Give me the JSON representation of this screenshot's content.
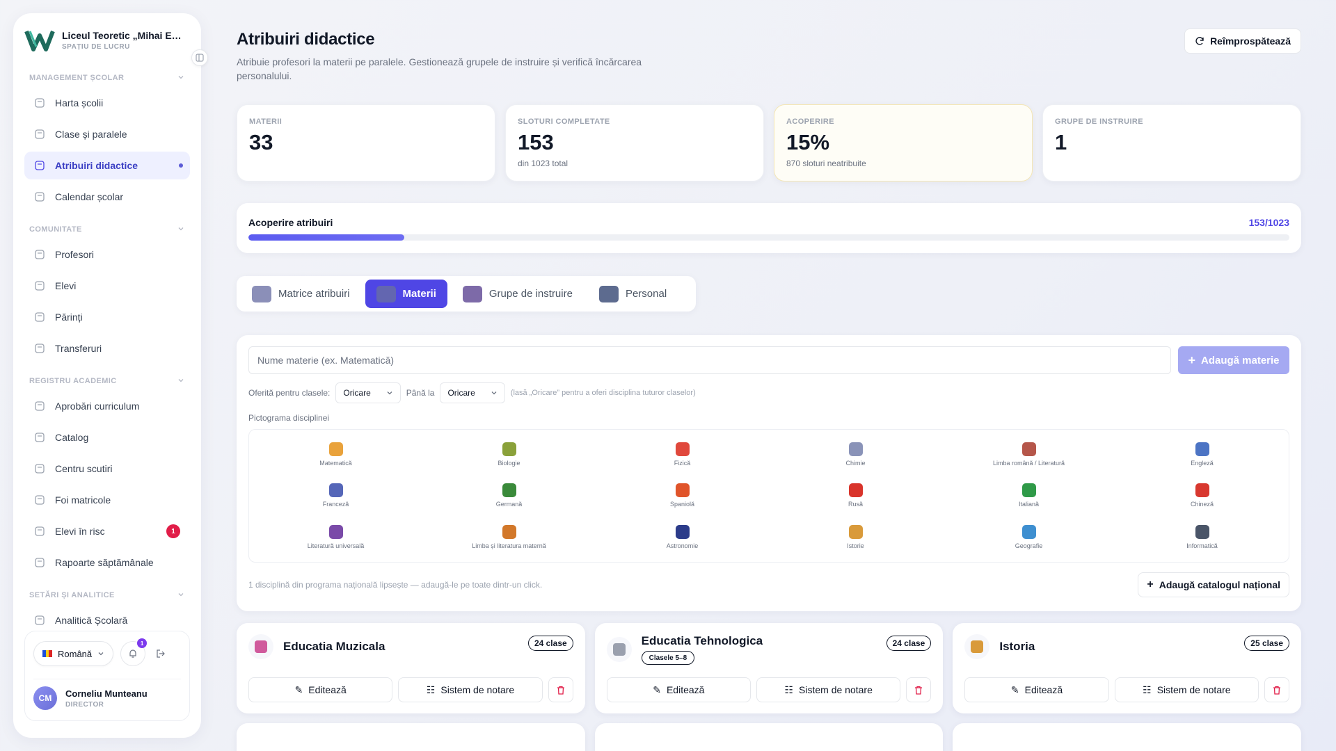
{
  "sidebar": {
    "school_name": "Liceul Teoretic „Mihai Emi…",
    "workspace_label": "SPAȚIU DE LUCRU",
    "sections": [
      {
        "title": "MANAGEMENT ȘCOLAR",
        "items": [
          {
            "label": "Harta școlii",
            "icon": "sitemap-icon"
          },
          {
            "label": "Clase și paralele",
            "icon": "layers-icon"
          },
          {
            "label": "Atribuiri didactice",
            "icon": "book-open-icon",
            "active": true
          },
          {
            "label": "Calendar școlar",
            "icon": "calendar-icon"
          }
        ]
      },
      {
        "title": "COMUNITATE",
        "items": [
          {
            "label": "Profesori",
            "icon": "users-icon"
          },
          {
            "label": "Elevi",
            "icon": "graduation-cap-icon"
          },
          {
            "label": "Părinți",
            "icon": "heart-icon"
          },
          {
            "label": "Transferuri",
            "icon": "transfer-icon"
          }
        ]
      },
      {
        "title": "REGISTRU ACADEMIC",
        "items": [
          {
            "label": "Aprobări curriculum",
            "icon": "notebook-icon"
          },
          {
            "label": "Catalog",
            "icon": "book-icon"
          },
          {
            "label": "Centru scutiri",
            "icon": "document-icon"
          },
          {
            "label": "Foi matricole",
            "icon": "file-text-icon"
          },
          {
            "label": "Elevi în risc",
            "icon": "shield-icon",
            "badge": "1"
          },
          {
            "label": "Rapoarte săptămânale",
            "icon": "clipboard-icon"
          }
        ]
      },
      {
        "title": "SETĂRI ȘI ANALITICE",
        "items": [
          {
            "label": "Analitică Școlară",
            "icon": "bar-chart-icon"
          }
        ]
      }
    ],
    "language": "Română",
    "notification_count": "1",
    "user": {
      "initials": "CM",
      "name": "Corneliu Munteanu",
      "role": "DIRECTOR"
    }
  },
  "header": {
    "title": "Atribuiri didactice",
    "subtitle": "Atribuie profesori la materii pe paralele. Gestionează grupele de instruire și verifică încărcarea personalului.",
    "refresh_label": "Reîmprospătează"
  },
  "stats": [
    {
      "label": "MATERII",
      "value": "33",
      "note": ""
    },
    {
      "label": "SLOTURI COMPLETATE",
      "value": "153",
      "note": "din 1023 total"
    },
    {
      "label": "ACOPERIRE",
      "value": "15%",
      "note": "870 sloturi neatribuite"
    },
    {
      "label": "GRUPE DE INSTRUIRE",
      "value": "1",
      "note": ""
    }
  ],
  "coverage": {
    "title": "Acoperire atribuiri",
    "value_text": "153/1023",
    "filled": 153,
    "total": 1023
  },
  "tabs": [
    {
      "label": "Matrice atribuiri",
      "icon": "matrix-icon",
      "color": "#8b8fb8"
    },
    {
      "label": "Materii",
      "icon": "subjects-icon",
      "color": "#6366b0",
      "active": true
    },
    {
      "label": "Grupe de instruire",
      "icon": "groups-icon",
      "color": "#7d6aa8"
    },
    {
      "label": "Personal",
      "icon": "staff-icon",
      "color": "#5d6b8f"
    }
  ],
  "form": {
    "name_placeholder": "Nume materie (ex. Matematică)",
    "add_label": "Adaugă materie",
    "offered_label": "Oferită pentru clasele:",
    "from_value": "Oricare",
    "until_label": "Până la",
    "to_value": "Oricare",
    "hint": "(lasă „Oricare” pentru a oferi disciplina tuturor claselor)",
    "icon_label": "Pictograma disciplinei"
  },
  "subjects": [
    {
      "name": "Matematică",
      "color": "#e9a23b"
    },
    {
      "name": "Biologie",
      "color": "#8aa13a"
    },
    {
      "name": "Fizică",
      "color": "#e0483c"
    },
    {
      "name": "Chimie",
      "color": "#8a93b8"
    },
    {
      "name": "Limba română / Literatură",
      "color": "#b5564a"
    },
    {
      "name": "Engleză",
      "color": "#4c74c4"
    },
    {
      "name": "Franceză",
      "color": "#5566b8"
    },
    {
      "name": "Germană",
      "color": "#3a8a3a"
    },
    {
      "name": "Spaniolă",
      "color": "#e0542a"
    },
    {
      "name": "Rusă",
      "color": "#d9342b"
    },
    {
      "name": "Italiană",
      "color": "#2f9a48"
    },
    {
      "name": "Chineză",
      "color": "#d8382f"
    },
    {
      "name": "Literatură universală",
      "color": "#7a4aa8"
    },
    {
      "name": "Limba și literatura maternă",
      "color": "#d2782a"
    },
    {
      "name": "Astronomie",
      "color": "#2c3c8a"
    },
    {
      "name": "Istorie",
      "color": "#d99a3a"
    },
    {
      "name": "Geografie",
      "color": "#3e8fd0"
    },
    {
      "name": "Informatică",
      "color": "#4a5568"
    }
  ],
  "footer": {
    "missing_note": "1 disciplină din programa națională lipsește — adaugă-le pe toate dintr-un click.",
    "catalog_label": "Adaugă catalogul național"
  },
  "cards": [
    {
      "title": "Educatia Muzicala",
      "count": "24 clase",
      "grade": "",
      "icon_color": "#d05a9c"
    },
    {
      "title": "Educatia Tehnologica",
      "count": "24 clase",
      "grade": "Clasele 5–8",
      "icon_color": "#9aa0ae"
    },
    {
      "title": "Istoria",
      "count": "25 clase",
      "grade": "",
      "icon_color": "#d99a3a"
    }
  ],
  "card_actions": {
    "edit": "Editează",
    "grading": "Sistem de notare"
  },
  "colors": {
    "accent": "#4f46e5",
    "danger": "#e11d48",
    "coverage_highlight": "#fefdf6"
  }
}
